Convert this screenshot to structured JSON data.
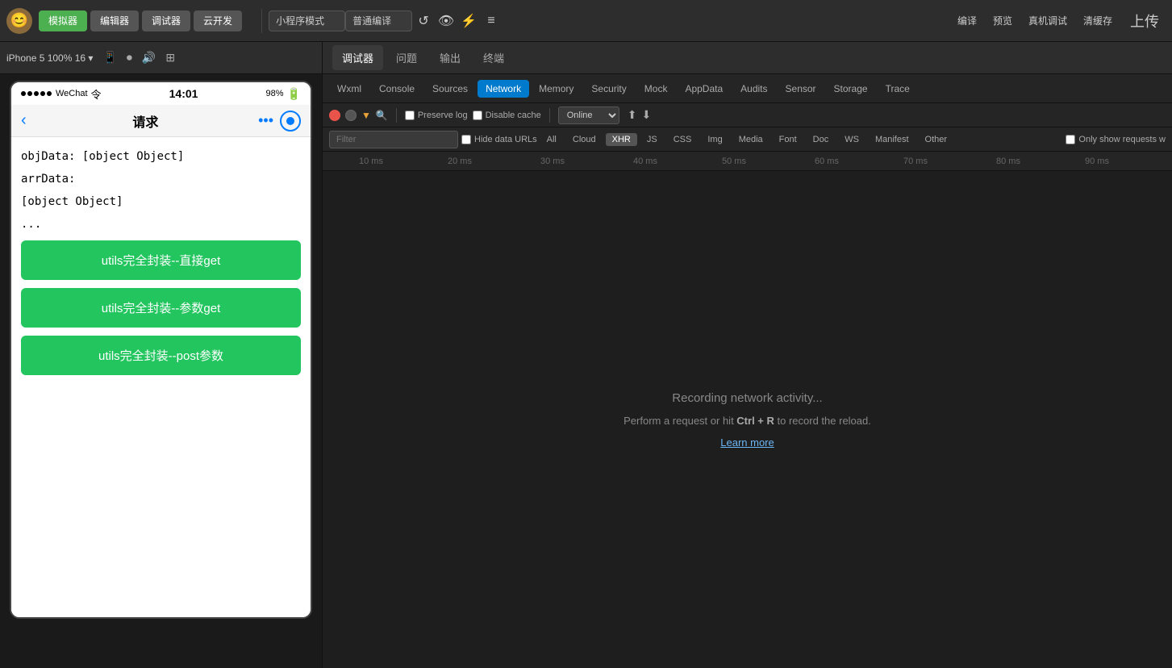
{
  "topToolbar": {
    "avatar_emoji": "😊",
    "simulatorLabel": "模拟器",
    "editorLabel": "编辑器",
    "debuggerLabel": "调试器",
    "cloudLabel": "云开发",
    "miniProgramMode": "小程序模式",
    "translationMode": "普通编译",
    "compileLabel": "编译",
    "previewLabel": "预览",
    "realDeviceLabel": "真机调试",
    "clearCacheLabel": "清缓存",
    "uploadLabel": "上传"
  },
  "simToolbar": {
    "deviceInfo": "iPhone 5  100%  16 ▾",
    "icons": [
      "phone",
      "record",
      "audio",
      "expand"
    ]
  },
  "device": {
    "status": {
      "dots": "•••••",
      "carrier": "WeChat",
      "wifi": "令",
      "time": "14:01",
      "battery_pct": "98%"
    },
    "navBar": {
      "backArrow": "‹",
      "title": "请求",
      "dots": "•••"
    },
    "content": {
      "text1": "objData: [object Object]",
      "text2": "arrData:",
      "text3": "[object Object]",
      "text4": "...",
      "btn1": "utils完全封装--直接get",
      "btn2": "utils完全封装--参数get",
      "btn3": "utils完全封装--post参数"
    }
  },
  "devtools": {
    "topTabs": [
      {
        "id": "debugger",
        "label": "调试器",
        "active": true
      },
      {
        "id": "issue",
        "label": "问题"
      },
      {
        "id": "output",
        "label": "输出"
      },
      {
        "id": "terminal",
        "label": "终端"
      }
    ],
    "subTabs": [
      {
        "id": "wxml",
        "label": "Wxml"
      },
      {
        "id": "console",
        "label": "Console"
      },
      {
        "id": "sources",
        "label": "Sources"
      },
      {
        "id": "network",
        "label": "Network",
        "active": true
      },
      {
        "id": "memory",
        "label": "Memory"
      },
      {
        "id": "security",
        "label": "Security"
      },
      {
        "id": "mock",
        "label": "Mock"
      },
      {
        "id": "appdata",
        "label": "AppData"
      },
      {
        "id": "audits",
        "label": "Audits"
      },
      {
        "id": "sensor",
        "label": "Sensor"
      },
      {
        "id": "storage",
        "label": "Storage"
      },
      {
        "id": "trace",
        "label": "Trace"
      }
    ],
    "networkToolbar": {
      "recordBtn": "⏺",
      "stopBtn": "⏹",
      "filterBtn": "▼",
      "searchBtn": "🔍",
      "preserveLog": "Preserve log",
      "disableCache": "Disable cache",
      "online": "Online",
      "uploadIcon": "⬆",
      "downloadIcon": "⬇"
    },
    "filterBar": {
      "placeholder": "Filter",
      "hideDataUrls": "Hide data URLs",
      "tabs": [
        {
          "id": "all",
          "label": "All"
        },
        {
          "id": "cloud",
          "label": "Cloud"
        },
        {
          "id": "xhr",
          "label": "XHR",
          "active": true
        },
        {
          "id": "js",
          "label": "JS"
        },
        {
          "id": "css",
          "label": "CSS"
        },
        {
          "id": "img",
          "label": "Img"
        },
        {
          "id": "media",
          "label": "Media"
        },
        {
          "id": "font",
          "label": "Font"
        },
        {
          "id": "doc",
          "label": "Doc"
        },
        {
          "id": "ws",
          "label": "WS"
        },
        {
          "id": "manifest",
          "label": "Manifest"
        },
        {
          "id": "other",
          "label": "Other"
        }
      ],
      "onlyShowLabel": "Only show requests w"
    },
    "timeline": {
      "ticks": [
        "10 ms",
        "20 ms",
        "30 ms",
        "40 ms",
        "50 ms",
        "60 ms",
        "70 ms",
        "80 ms",
        "90 ms"
      ]
    },
    "emptyState": {
      "recordingText": "Recording network activity...",
      "performText1": "Perform a request or hit ",
      "shortcut": "Ctrl + R",
      "performText2": " to record the reload.",
      "learnMoreLabel": "Learn more"
    }
  },
  "colors": {
    "green": "#22c55e",
    "activeTab": "#007acc",
    "xhrBadge": "#555"
  }
}
